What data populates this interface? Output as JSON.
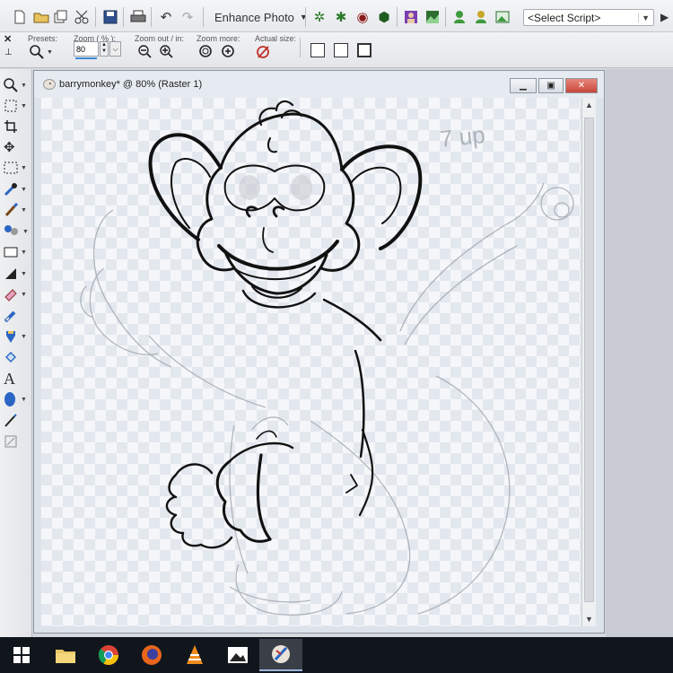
{
  "toolbar": {
    "enhance_label": "Enhance Photo",
    "script_select": "<Select Script>"
  },
  "tool_options": {
    "presets_label": "Presets:",
    "zoom_label": "Zoom ( % ):",
    "zoom_value": "80",
    "zoom_out_label": "Zoom out / in:",
    "zoom_more_label": "Zoom more:",
    "actual_size_label": "Actual size:"
  },
  "document": {
    "title": "barrymonkey* @  80% (Raster 1)",
    "sketch_note": "7 up"
  },
  "toolbox": {
    "text_tool_glyph": "A"
  },
  "colors": {
    "accent": "#3c8ad6",
    "taskbar": "#11161d",
    "close_button": "#c8463a"
  }
}
